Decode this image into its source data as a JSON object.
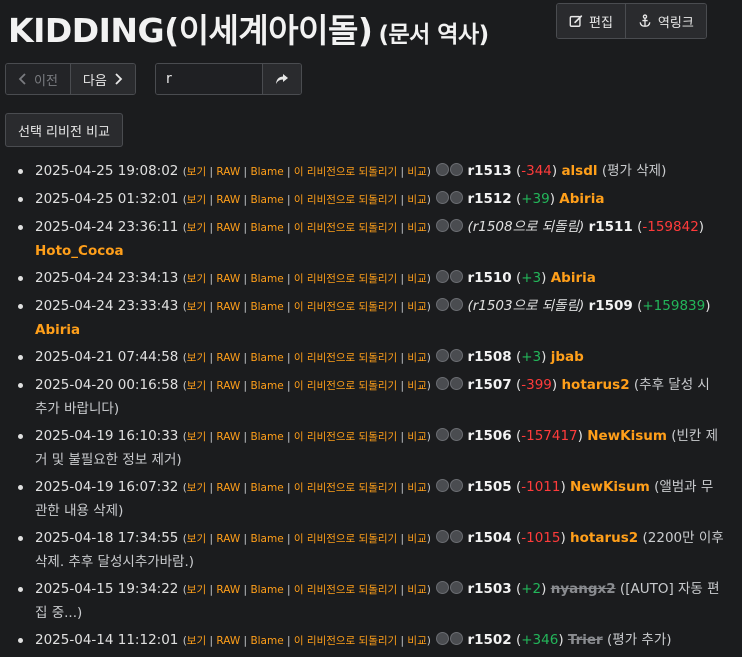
{
  "header": {
    "title": "KIDDING(이세계아이돌)",
    "subtitle": "(문서 역사)",
    "edit_label": "편집",
    "backlink_label": "역링크"
  },
  "nav": {
    "prev_label": "이전",
    "next_label": "다음"
  },
  "search": {
    "value": "r"
  },
  "compare_label": "선택 리비전 비교",
  "link_labels": [
    "보기",
    "RAW",
    "Blame",
    "이 리비전으로 되돌리기",
    "비교"
  ],
  "history": [
    {
      "date": "2025-04-25 19:08:02",
      "note": "",
      "rev": "r1513",
      "change": "-344",
      "sign": "neg",
      "user": "alsdl",
      "user_strike": false,
      "comment": "평가 삭제"
    },
    {
      "date": "2025-04-25 01:32:01",
      "note": "",
      "rev": "r1512",
      "change": "+39",
      "sign": "pos",
      "user": "Abiria",
      "user_strike": false,
      "comment": ""
    },
    {
      "date": "2025-04-24 23:36:11",
      "note": "(r1508으로 되돌림)",
      "rev": "r1511",
      "change": "-159842",
      "sign": "neg",
      "user": "Hoto_Cocoa",
      "user_strike": false,
      "comment": ""
    },
    {
      "date": "2025-04-24 23:34:13",
      "note": "",
      "rev": "r1510",
      "change": "+3",
      "sign": "pos",
      "user": "Abiria",
      "user_strike": false,
      "comment": ""
    },
    {
      "date": "2025-04-24 23:33:43",
      "note": "(r1503으로 되돌림)",
      "rev": "r1509",
      "change": "+159839",
      "sign": "pos",
      "user": "Abiria",
      "user_strike": false,
      "comment": ""
    },
    {
      "date": "2025-04-21 07:44:58",
      "note": "",
      "rev": "r1508",
      "change": "+3",
      "sign": "pos",
      "user": "jbab",
      "user_strike": false,
      "comment": ""
    },
    {
      "date": "2025-04-20 00:16:58",
      "note": "",
      "rev": "r1507",
      "change": "-399",
      "sign": "neg",
      "user": "hotarus2",
      "user_strike": false,
      "comment": "추후 달성 시 추가 바랍니다"
    },
    {
      "date": "2025-04-19 16:10:33",
      "note": "",
      "rev": "r1506",
      "change": "-157417",
      "sign": "neg",
      "user": "NewKisum",
      "user_strike": false,
      "comment": "빈칸 제거 및 불필요한 정보 제거"
    },
    {
      "date": "2025-04-19 16:07:32",
      "note": "",
      "rev": "r1505",
      "change": "-1011",
      "sign": "neg",
      "user": "NewKisum",
      "user_strike": false,
      "comment": "앨범과 무관한 내용 삭제"
    },
    {
      "date": "2025-04-18 17:34:55",
      "note": "",
      "rev": "r1504",
      "change": "-1015",
      "sign": "neg",
      "user": "hotarus2",
      "user_strike": false,
      "comment": "2200만 이후 삭제. 추후 달성시추가바람."
    },
    {
      "date": "2025-04-15 19:34:22",
      "note": "",
      "rev": "r1503",
      "change": "+2",
      "sign": "pos",
      "user": "nyangx2",
      "user_strike": true,
      "comment": "[AUTO] 자동 편집 중..."
    },
    {
      "date": "2025-04-14 11:12:01",
      "note": "",
      "rev": "r1502",
      "change": "+346",
      "sign": "pos",
      "user": "Trier",
      "user_strike": true,
      "comment": "평가 추가"
    }
  ],
  "icons": {
    "edit": "pencil-square-icon",
    "backlink": "anchor-icon",
    "prev": "chevron-left-icon",
    "next": "chevron-right-icon",
    "go": "share-arrow-icon"
  },
  "colors": {
    "background": "#1b1c1e",
    "link": "#ff9f1a",
    "negative": "#ff3b3b",
    "positive": "#23b65a"
  }
}
